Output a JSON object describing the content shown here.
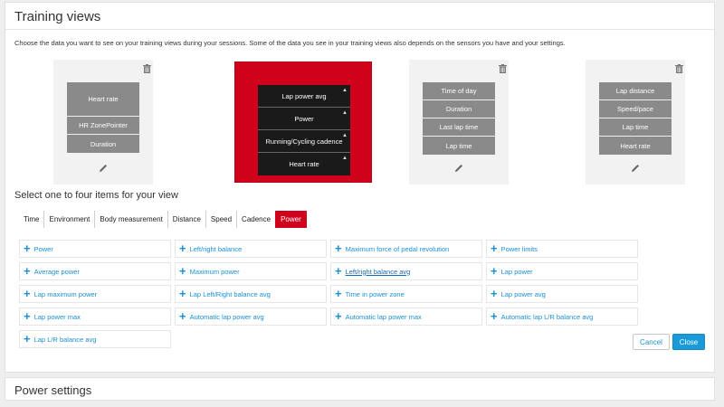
{
  "training_views": {
    "title": "Training views",
    "intro": "Choose the data you want to see on your training views during your sessions. Some of the data you see in your training views also depends on the sensors you have and your settings."
  },
  "views": [
    {
      "items": [
        "Heart rate",
        "HR ZonePointer",
        "Duration"
      ],
      "selected": false
    },
    {
      "items": [
        "Lap power avg",
        "Power",
        "Running/Cycling cadence",
        "Heart rate"
      ],
      "selected": true
    },
    {
      "items": [
        "Time of day",
        "Duration",
        "Last lap time",
        "Lap time"
      ],
      "selected": false
    },
    {
      "items": [
        "Lap distance",
        "Speed/pace",
        "Lap time",
        "Heart rate"
      ],
      "selected": false
    }
  ],
  "selector": {
    "heading": "Select one to four items for your view",
    "tabs": [
      "Time",
      "Environment",
      "Body measurement",
      "Distance",
      "Speed",
      "Cadence",
      "Power"
    ],
    "active_tab": "Power"
  },
  "items": [
    "Power",
    "Left/right balance",
    "Maximum force of pedal revolution",
    "Power limits",
    "Average power",
    "Maximum power",
    "Left/right balance avg",
    "Lap power",
    "Lap maximum power",
    "Lap Left/Right balance avg",
    "Time in power zone",
    "Lap power avg",
    "Lap power max",
    "Automatic lap power avg",
    "Automatic lap power max",
    "Automatic lap L/R balance avg",
    "Lap L/R balance avg"
  ],
  "buttons": {
    "cancel": "Cancel",
    "close": "Close"
  },
  "power_settings": {
    "title": "Power settings"
  },
  "colors": {
    "accent_red": "#d0021b",
    "link_blue": "#1a8fd3",
    "button_blue": "#1a9ad9"
  }
}
